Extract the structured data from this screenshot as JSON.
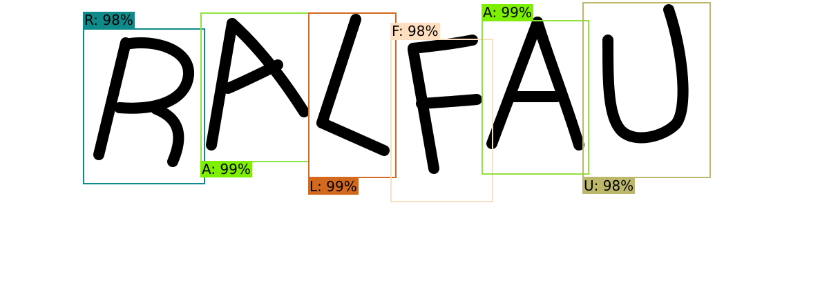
{
  "detections": [
    {
      "label": "R: 98%",
      "color": "#0f8a8a",
      "tag_color": "#0f8a8a",
      "letter": "R"
    },
    {
      "label": "A: 99%",
      "color": "#8fe33b",
      "tag_color": "#7cf000",
      "letter": "A"
    },
    {
      "label": "L: 99%",
      "color": "#d2691e",
      "tag_color": "#d2691e",
      "letter": "L"
    },
    {
      "label": "F: 98%",
      "color": "#f7dfbf",
      "tag_color": "#ffdfbf",
      "letter": "F"
    },
    {
      "label": "A: 99%",
      "color": "#8fe33b",
      "tag_color": "#7cf000",
      "letter": "A"
    },
    {
      "label": "U: 98%",
      "color": "#bdb76b",
      "tag_color": "#bdb76b",
      "letter": "U"
    }
  ]
}
